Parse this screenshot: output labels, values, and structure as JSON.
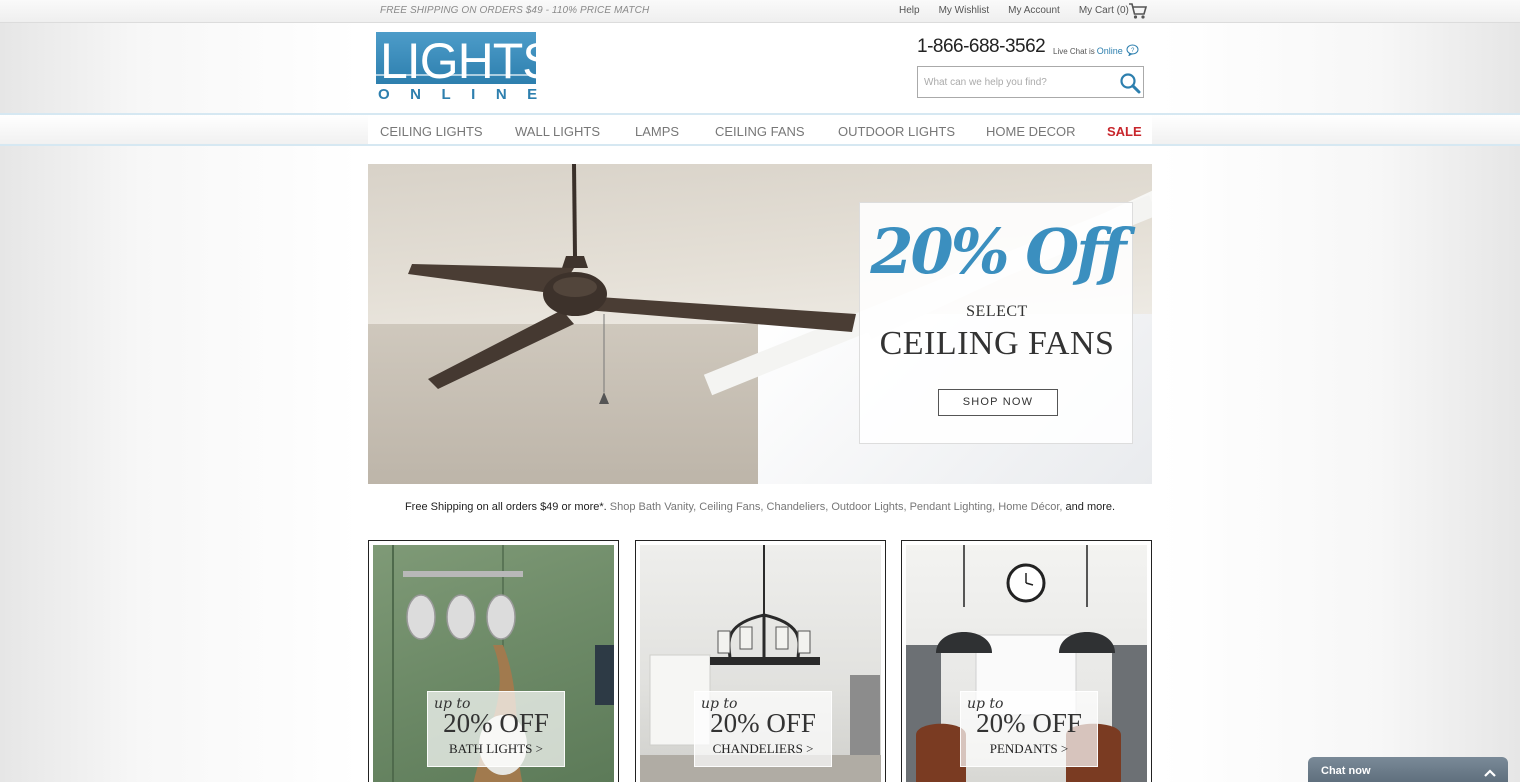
{
  "topbar": {
    "promo": "FREE SHIPPING ON ORDERS $49 - 110% PRICE MATCH",
    "links": [
      "Help",
      "My Wishlist",
      "My Account",
      "My Cart (0)"
    ]
  },
  "header": {
    "logo_top": "LIGHTS",
    "logo_bottom": "ONLINE",
    "phone": "1-866-688-3562",
    "livechat_prefix": "Live Chat is",
    "livechat_status": "Online",
    "search_placeholder": "What can we help you find?"
  },
  "nav": {
    "items": [
      "CEILING LIGHTS",
      "WALL LIGHTS",
      "LAMPS",
      "CEILING FANS",
      "OUTDOOR LIGHTS",
      "HOME DECOR",
      "SALE"
    ]
  },
  "hero": {
    "discount": "20% Off",
    "select": "SELECT",
    "category": "CEILING FANS",
    "button": "SHOP NOW"
  },
  "shipping": {
    "lead": "Free Shipping on all orders $49 or more*.",
    "categories": "Shop Bath Vanity, Ceiling Fans, Chandeliers, Outdoor Lights, Pendant Lighting, Home Décor,",
    "tail": "and more."
  },
  "tiles": [
    {
      "upto": "up to",
      "pct": "20% OFF",
      "cat": "BATH LIGHTS >"
    },
    {
      "upto": "up to",
      "pct": "20% OFF",
      "cat": "CHANDELIERS >"
    },
    {
      "upto": "up to",
      "pct": "20% OFF",
      "cat": "PENDANTS >"
    }
  ],
  "chat": {
    "label": "Chat now"
  },
  "colors": {
    "brand": "#2d7fae",
    "sale": "#c8262c",
    "chat": "#6b7b89"
  }
}
